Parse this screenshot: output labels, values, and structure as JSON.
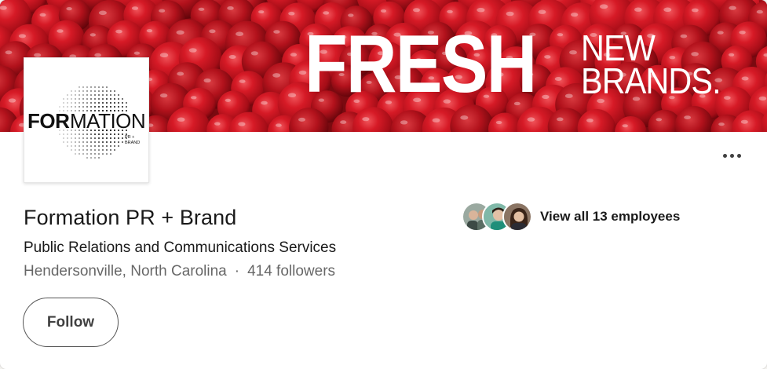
{
  "banner": {
    "headline_big": "FRESH",
    "headline_small_line1": "NEW",
    "headline_small_line2": "BRANDS.",
    "background_color": "#8f0c14"
  },
  "logo": {
    "wordmark": "FORMATION",
    "tagline_line1": "PR +",
    "tagline_line2": "BRAND"
  },
  "company": {
    "name": "Formation PR + Brand",
    "industry": "Public Relations and Communications Services",
    "location": "Hendersonville, North Carolina",
    "separator": "·",
    "followers": "414 followers"
  },
  "employees": {
    "label": "View all 13 employees",
    "avatar_count": 3
  },
  "actions": {
    "follow_label": "Follow",
    "more_icon": "ellipsis-icon"
  }
}
